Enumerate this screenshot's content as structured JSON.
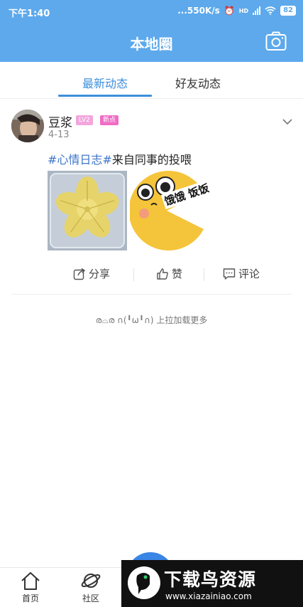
{
  "status_bar": {
    "time": "下午1:40",
    "network_speed": "...550K/s",
    "network_label": "HD",
    "battery": "82"
  },
  "header": {
    "title": "本地圈",
    "camera_icon": "camera-icon"
  },
  "tabs": [
    {
      "label": "最新动态",
      "active": true
    },
    {
      "label": "好友动态",
      "active": false
    }
  ],
  "post": {
    "username": "豆浆",
    "level_badge": "LV2",
    "tag_badge": "新点",
    "date": "4-13",
    "topic": "#心情日志#",
    "text": "来自同事的投喂",
    "meme_text": "饿饿 饭饭",
    "actions": {
      "share": "分享",
      "like": "赞",
      "comment": "评论"
    }
  },
  "load_more": "ര⌓ര ∩(╹ω╹∩) 上拉加载更多",
  "bottom_nav": [
    {
      "label": "首页",
      "icon": "home-icon"
    },
    {
      "label": "社区",
      "icon": "planet-icon"
    }
  ],
  "watermark": {
    "title": "下载鸟资源",
    "url": "www.xiazainiao.com"
  },
  "colors": {
    "header_bg": "#5da9ec",
    "accent": "#3d8fdc",
    "topic": "#3d75c9"
  }
}
